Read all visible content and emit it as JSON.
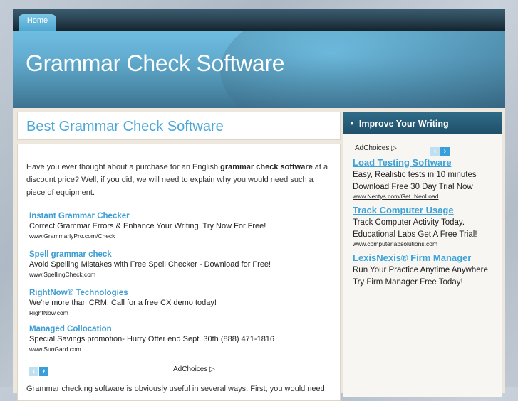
{
  "nav": {
    "home_label": "Home"
  },
  "header": {
    "site_title": "Grammar Check Software"
  },
  "post": {
    "title": "Best Grammar Check Software",
    "intro_before": "Have you ever thought about a purchase for an English ",
    "intro_bold": "grammar check software",
    "intro_after": " at a discount price? Well, if you did, we will need to explain why you would need such a piece of equipment.",
    "paragraph2": "Grammar checking software is obviously useful in several ways. First, you would need"
  },
  "main_ads": {
    "items": [
      {
        "title": "Instant Grammar Checker",
        "desc": "Correct Grammar Errors & Enhance Your Writing. Try Now For Free!",
        "url": "www.GrammarlyPro.com/Check"
      },
      {
        "title": "Spell grammar check",
        "desc": "Avoid Spelling Mistakes with Free Spell Checker - Download for Free!",
        "url": "www.SpellingCheck.com"
      },
      {
        "title": "RightNow® Technologies",
        "desc": "We're more than CRM. Call for a free CX demo today!",
        "url": "RightNow.com"
      },
      {
        "title": "Managed Collocation",
        "desc": "Special Savings promotion- Hurry Offer end Sept. 30th (888) 471-1816",
        "url": "www.SunGard.com"
      }
    ],
    "prev_icon": "‹",
    "next_icon": "›",
    "adchoices_label": "AdChoices ▷"
  },
  "sidebar": {
    "heading": "Improve Your Writing",
    "heading_icon": "▼",
    "adchoices_label": "AdChoices ▷",
    "prev_icon": "‹",
    "next_icon": "›",
    "ads": [
      {
        "title": "Load Testing Software",
        "desc": "Easy, Realistic tests in 10 minutes Download Free 30 Day Trial Now",
        "url": "www.Neotys.com/Get_NeoLoad"
      },
      {
        "title": "Track Computer Usage",
        "desc": "Track Computer Activity Today. Educational Labs Get A Free Trial!",
        "url": "www.computerlabsolutions.com"
      },
      {
        "title": "LexisNexis® Firm Manager",
        "desc": "Run Your Practice Anytime Anywhere Try Firm Manager Free Today!",
        "url": ""
      }
    ]
  }
}
